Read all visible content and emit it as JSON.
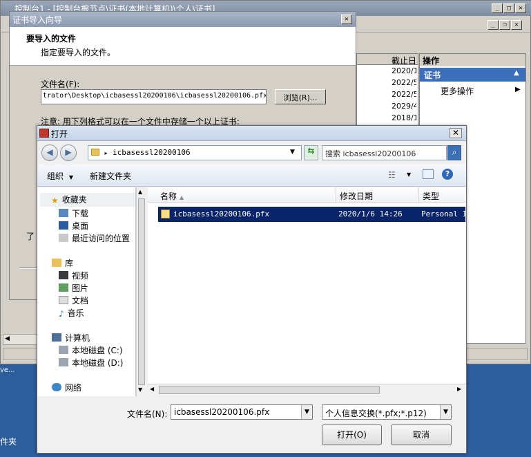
{
  "mmc": {
    "title": "控制台1 - [控制台根节点\\证书(本地计算机)\\个人\\证书]",
    "list": {
      "col_expiry": "截止日",
      "dates": [
        "2020/1",
        "2022/5",
        "2022/5",
        "2029/4",
        "2018/1"
      ]
    },
    "actions": {
      "header": "操作",
      "section": "证书",
      "more": "更多操作"
    }
  },
  "wizard": {
    "title": "证书导入向导",
    "heading": "要导入的文件",
    "subheading": "指定要导入的文件。",
    "filename_label": "文件名(F):",
    "filename_value": "trator\\Desktop\\icbasessl20200106\\icbasessl20200106.pfx",
    "browse_label": "浏览(R)...",
    "note": "注意: 用下列格式可以在一个文件中存储一个以上证书:",
    "fragment": "了"
  },
  "desktop": {
    "frag1": "ve...",
    "frag2": "件夹"
  },
  "open_dialog": {
    "title": "打开",
    "address": "icbasessl20200106",
    "search_placeholder": "搜索 icbasessl20200106",
    "organize": "组织",
    "new_folder": "新建文件夹",
    "nav": {
      "favorites": "收藏夹",
      "downloads": "下载",
      "desktop": "桌面",
      "recent": "最近访问的位置",
      "libraries": "库",
      "videos": "视频",
      "pictures": "图片",
      "documents": "文档",
      "music": "音乐",
      "computer": "计算机",
      "disk_c": "本地磁盘 (C:)",
      "disk_d": "本地磁盘 (D:)",
      "network": "网络"
    },
    "columns": {
      "name": "名称",
      "modified": "修改日期",
      "type": "类型"
    },
    "files": [
      {
        "name": "icbasessl20200106.pfx",
        "modified": "2020/1/6 14:26",
        "type": "Personal I"
      }
    ],
    "filename_label": "文件名(N):",
    "filename_value": "icbasessl20200106.pfx",
    "filetype_value": "个人信息交换(*.pfx;*.p12)",
    "open_button": "打开(O)",
    "cancel_button": "取消"
  }
}
